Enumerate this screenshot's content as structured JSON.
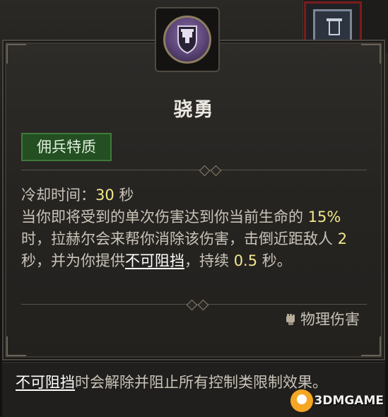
{
  "tooltip": {
    "title": "骁勇",
    "tag": "佣兵特质",
    "cooldown_label": "冷却时间：",
    "cooldown_value": "30",
    "cooldown_unit": " 秒",
    "desc_1": "当你即将受到的单次伤害达到你当前生命的",
    "percent": "15%",
    "desc_2": " 时，拉赫尔会来帮你消除该伤害，击倒近距敌人",
    "stun": "2",
    "desc_3": " 秒，并为你提供",
    "unstoppable": "不可阻挡",
    "desc_4": "，持续",
    "duration": "0.5",
    "desc_5": " 秒。",
    "damage_type": "物理伤害",
    "damage_icon": "fist-icon"
  },
  "footer": {
    "term": "不可阻挡",
    "text": "时会解除并阻止所有控制类限制效果。"
  },
  "watermark": {
    "text": "3DMGAME"
  },
  "colors": {
    "highlight": "#f1e78c",
    "tag_bg": "#234f22",
    "emblem": "#5b4476"
  }
}
